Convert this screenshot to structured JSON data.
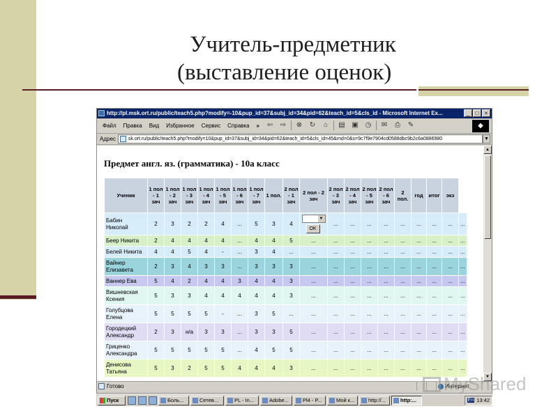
{
  "slide": {
    "title_line1": "Учитель-предметник",
    "title_line2": "(выставление оценок)"
  },
  "browser": {
    "title": "http://pl.msk.ort.ru/public/teach5.php?modify=-10&pup_id=37&subj_id=34&pid=62&teach_id=5&cls_id - Microsoft Internet Ex...",
    "window_buttons": [
      "_",
      "□",
      "×"
    ],
    "menu": [
      "Файл",
      "Правка",
      "Вид",
      "Избранное",
      "Сервис",
      "Справка"
    ],
    "menu_more": "»",
    "toolbar_icons": [
      "back-arrow-icon",
      "forward-arrow-icon",
      "stop-icon",
      "refresh-icon",
      "home-icon",
      "search-icon",
      "favorites-icon",
      "history-icon",
      "mail-icon",
      "print-icon",
      "edit-icon"
    ],
    "toolbar_glyphs": [
      "⇦",
      "⇨",
      "⊗",
      "↻",
      "⌂",
      "▤",
      "▣",
      "◷",
      "✉",
      "⎙",
      "✎"
    ],
    "address_label": "Адрес",
    "address_value": "sk.ort.ru/public/teach5.php?modify=10&pup_id=37&subj_id=34&pid=62&teach_id=5&cls_id=45&rnd=0&s=9c7f9e7904cd0588dbc9b2c6a0886980",
    "status_text": "Готово",
    "status_zone": "Интернет"
  },
  "page": {
    "heading": "Предмет англ. яз. (грамматика) - 10а класс",
    "columns": [
      "Ученик",
      "1 пол - 1 зач",
      "1 пол - 2 зач",
      "1 пол - 3 зач",
      "1 пол - 4 зач",
      "1 пол - 5 зач",
      "1 пол - 6 зач",
      "1 пол - 7 зач",
      "1 пол.",
      "2 пол - 1 зач",
      "2 пол - 2 зач",
      "2 пол - 3 зач",
      "2 пол - 4 зач",
      "2 пол - 5 зач",
      "2 пол - 6 зач",
      "2 пол.",
      "год",
      "итог",
      "экз"
    ],
    "rows": [
      {
        "name": "Бабин Николай",
        "cells": [
          "2",
          "3",
          "2",
          "2",
          "4",
          "...",
          "5",
          "3",
          "4",
          "",
          "...",
          "...",
          "...",
          "...",
          "...",
          "...",
          "...",
          "...",
          "..."
        ]
      },
      {
        "name": "Беер Никита",
        "cells": [
          "2",
          "4",
          "4",
          "4",
          "4",
          "...",
          "4",
          "4",
          "5",
          "...",
          "...",
          "...",
          "...",
          "...",
          "...",
          "...",
          "...",
          "...",
          "..."
        ]
      },
      {
        "name": "Белей Никита",
        "cells": [
          "4",
          "4",
          "5",
          "4",
          "-",
          "...",
          "3",
          "4",
          "...",
          "...",
          "...",
          "...",
          "...",
          "...",
          "...",
          "...",
          "...",
          "...",
          "..."
        ]
      },
      {
        "name": "Вайнер Елизавета",
        "cells": [
          "2",
          "3",
          "4",
          "3",
          "3",
          "...",
          "3",
          "3",
          "3",
          "...",
          "...",
          "...",
          "...",
          "...",
          "...",
          "...",
          "...",
          "...",
          "..."
        ]
      },
      {
        "name": "Ваннер Ева",
        "cells": [
          "5",
          "4",
          "2",
          "4",
          "4",
          "3",
          "4",
          "4",
          "3",
          "...",
          "...",
          "...",
          "...",
          "...",
          "...",
          "...",
          "...",
          "...",
          "..."
        ]
      },
      {
        "name": "Вишневская Ксения",
        "cells": [
          "5",
          "3",
          "3",
          "4",
          "4",
          "4",
          "4",
          "4",
          "3",
          "...",
          "...",
          "...",
          "...",
          "...",
          "...",
          "...",
          "...",
          "...",
          "..."
        ]
      },
      {
        "name": "Голубцова Елена",
        "cells": [
          "5",
          "5",
          "5",
          "5",
          "-",
          "...",
          "3",
          "5",
          "...",
          "...",
          "...",
          "...",
          "...",
          "...",
          "...",
          "...",
          "...",
          "...",
          "..."
        ]
      },
      {
        "name": "Городецкий Александр",
        "cells": [
          "2",
          "3",
          "н/а",
          "3",
          "3",
          "...",
          "3",
          "3",
          "5",
          "...",
          "...",
          "...",
          "...",
          "...",
          "...",
          "...",
          "...",
          "...",
          "..."
        ]
      },
      {
        "name": "Гриценко Александра",
        "cells": [
          "5",
          "5",
          "5",
          "5",
          "5",
          "...",
          "4",
          "5",
          "5",
          "...",
          "...",
          "...",
          "...",
          "...",
          "...",
          "...",
          "...",
          "...",
          "..."
        ]
      },
      {
        "name": "Денисова Татьяна",
        "cells": [
          "5",
          "3",
          "2",
          "5",
          "5",
          "4",
          "4",
          "4",
          "3",
          "...",
          "...",
          "...",
          "...",
          "...",
          "...",
          "...",
          "...",
          "...",
          "..."
        ]
      }
    ],
    "ok_label": "OK"
  },
  "taskbar": {
    "start": "Пуск",
    "tasks": [
      "Боль...",
      "Сетев...",
      "PL - In...",
      "Adobe...",
      "Pl4 - P...",
      "Мой к...",
      "http://...",
      "http:..."
    ],
    "lang": "En",
    "clock": "13:42"
  },
  "watermark": "MyShared"
}
